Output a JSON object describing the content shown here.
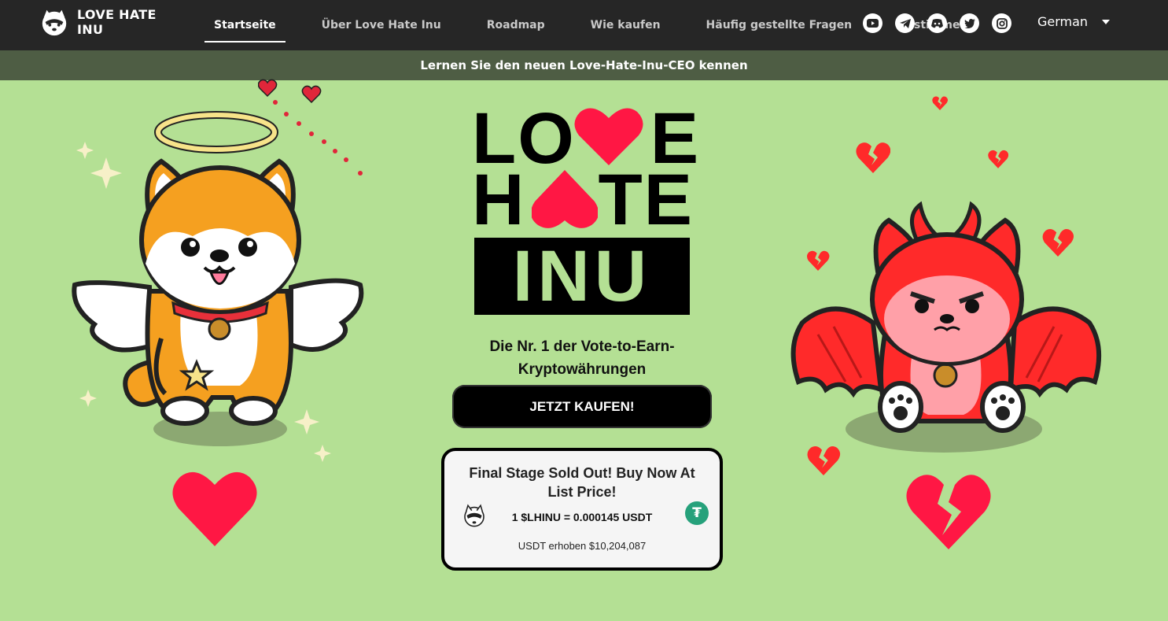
{
  "brand": {
    "name": "LOVE HATE INU",
    "logo_icon": "inu-logo-icon"
  },
  "nav": {
    "items": [
      {
        "label": "Startseite",
        "active": true
      },
      {
        "label": "Über Love Hate Inu",
        "active": false
      },
      {
        "label": "Roadmap",
        "active": false
      },
      {
        "label": "Wie kaufen",
        "active": false
      },
      {
        "label": "Häufig gestellte Fragen",
        "active": false
      },
      {
        "label": "Abstimmen",
        "active": false
      }
    ]
  },
  "socials": [
    "youtube-icon",
    "telegram-icon",
    "discord-icon",
    "twitter-icon",
    "instagram-icon"
  ],
  "language": {
    "selected": "German"
  },
  "announcement": "Lernen Sie den neuen Love-Hate-Inu-CEO kennen",
  "hero": {
    "line1_a": "LO",
    "line1_b": "E",
    "line2_a": "H",
    "line2_b": "TE",
    "line3": "INU",
    "tagline": "Die Nr. 1 der Vote-to-Earn-Kryptowährungen",
    "buy_label": "JETZT KAUFEN!"
  },
  "presale": {
    "title": "Final Stage Sold Out! Buy Now At List Price!",
    "price": "1 $LHINU = 0.000145 USDT",
    "raised": "USDT erhoben $10,204,087",
    "currency_icon": "tether-icon"
  },
  "colors": {
    "background": "#b4e094",
    "header": "#262626",
    "announce_bar": "#4e5d44",
    "heart_red": "#ff1744",
    "devil_red": "#ff2a2a",
    "shiba_orange": "#f5a020"
  }
}
